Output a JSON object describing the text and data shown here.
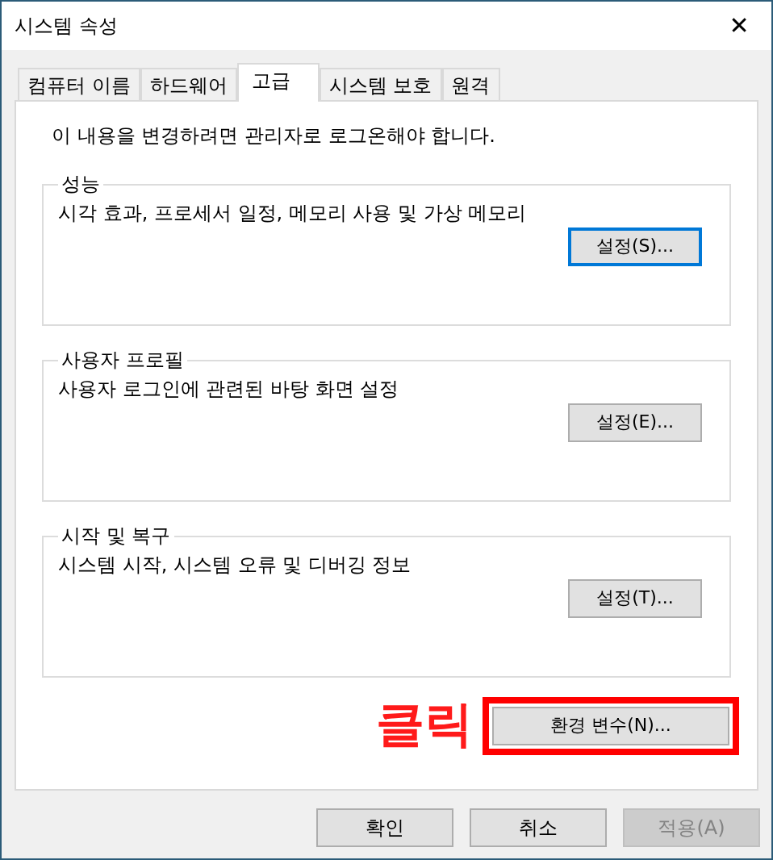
{
  "window": {
    "title": "시스템 속성",
    "close": "✕"
  },
  "tabs": [
    {
      "label": "컴퓨터 이름",
      "selected": false
    },
    {
      "label": "하드웨어",
      "selected": false
    },
    {
      "label": "고급",
      "selected": true
    },
    {
      "label": "시스템 보호",
      "selected": false
    },
    {
      "label": "원격",
      "selected": false
    }
  ],
  "notice": "이 내용을 변경하려면 관리자로 로그온해야 합니다.",
  "groups": [
    {
      "title": "성능",
      "description": "시각 효과, 프로세서 일정, 메모리 사용 및 가상 메모리",
      "button": "설정(S)..."
    },
    {
      "title": "사용자 프로필",
      "description": "사용자 로그인에 관련된 바탕 화면 설정",
      "button": "설정(E)..."
    },
    {
      "title": "시작 및 복구",
      "description": "시스템 시작, 시스템 오류 및 디버깅 정보",
      "button": "설정(T)..."
    }
  ],
  "env_button": {
    "label": "환경 변수(N)...",
    "highlighted": true
  },
  "annotation": "클릭",
  "footer_buttons": [
    {
      "label": "확인",
      "disabled": false
    },
    {
      "label": "취소",
      "disabled": false
    },
    {
      "label": "적용(A)",
      "disabled": true
    }
  ]
}
